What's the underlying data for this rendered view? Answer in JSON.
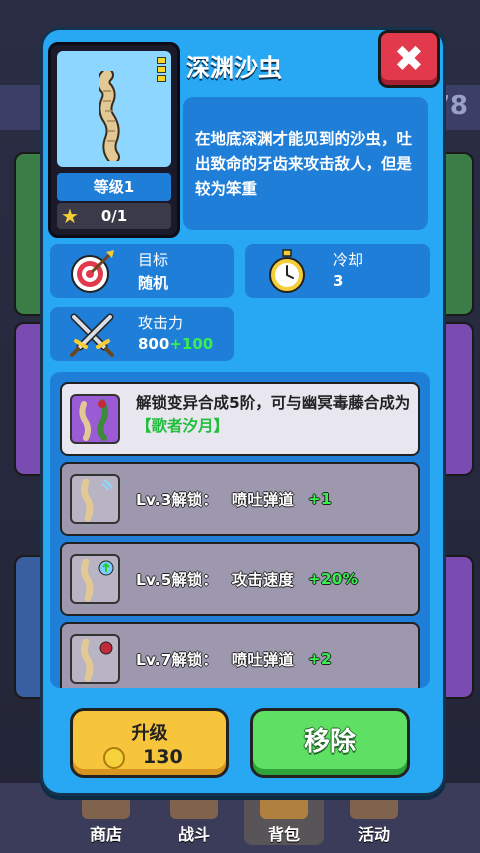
{
  "dialog": {
    "title": "深渊沙虫",
    "description": "在地底深渊才能见到的沙虫，吐出致命的牙齿来攻击敌人，但是较为笨重",
    "level": "等级1",
    "count": "0/1",
    "close_icon": "close-x-icon"
  },
  "stats": {
    "target": {
      "label": "目标",
      "value": "随机",
      "icon": "target-icon"
    },
    "cooldown": {
      "label": "冷却",
      "value": "3",
      "icon": "stopwatch-icon"
    },
    "attack": {
      "label": "攻击力",
      "base": "800",
      "bonus": "+100",
      "icon": "crossed-swords-icon"
    }
  },
  "unlocks": {
    "evolution": {
      "text": "解锁变异合成5阶，可与幽冥毒藤合成为",
      "result": "【歌者汐月】"
    },
    "items": [
      {
        "level": "Lv.3解锁：",
        "name": "喷吐弹道",
        "bonus": "+1"
      },
      {
        "level": "Lv.5解锁：",
        "name": "攻击速度",
        "bonus": "+20%"
      },
      {
        "level": "Lv.7解锁：",
        "name": "喷吐弹道",
        "bonus": "+2"
      }
    ]
  },
  "buttons": {
    "upgrade_label": "升级",
    "upgrade_cost": "130",
    "remove_label": "移除"
  },
  "background": {
    "level_text": "78"
  },
  "bottom_nav": [
    {
      "label": "商店"
    },
    {
      "label": "战斗"
    },
    {
      "label": "背包"
    },
    {
      "label": "活动"
    }
  ],
  "colors": {
    "dialog": "#28a8f3",
    "panel": "#1f7fd8",
    "bonus_green": "#36f050",
    "close_red": "#e2394d",
    "upgrade_yellow": "#f7c53c",
    "remove_green": "#5fe064"
  }
}
